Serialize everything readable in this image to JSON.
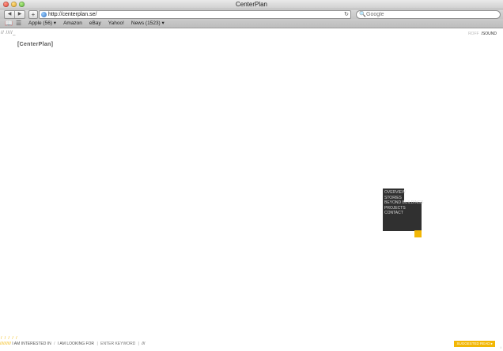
{
  "window": {
    "title": "CenterPlan"
  },
  "toolbar": {
    "back_icon": "◀",
    "forward_icon": "▶",
    "add_icon": "+",
    "url": "http://centerplan.se/",
    "reload_icon": "↻",
    "search_icon": "🔍",
    "search_placeholder": "Google"
  },
  "bookmarks": {
    "items": [
      "Apple (56) ▾",
      "Amazon",
      "eBay",
      "Yahoo!",
      "News (1523) ▾"
    ]
  },
  "page": {
    "top_slashes": "// ////_",
    "sound_off": "ROFF",
    "sound_label": "/SOUND",
    "logo": "[CenterPlan]",
    "menu": [
      "OVERVIEW",
      "STORIES",
      "BEYOND BUILDINGS",
      "PROJECTS",
      "CONTACT"
    ],
    "footer": {
      "slashes_above": "/ / / / /",
      "slashes": "//////////",
      "interested": "I AM INTERESTED IN",
      "sep1": "/",
      "looking": "I AM LOOKING FOR",
      "sep2": "|",
      "keyword_placeholder": "ENTER KEYWORD",
      "sep3": "|",
      "tail": "///"
    },
    "suggested": "SUGGESTED READ ▸",
    "corner_mark": "↕"
  },
  "colors": {
    "accent": "#f2b705",
    "menu_bg": "#303030"
  }
}
